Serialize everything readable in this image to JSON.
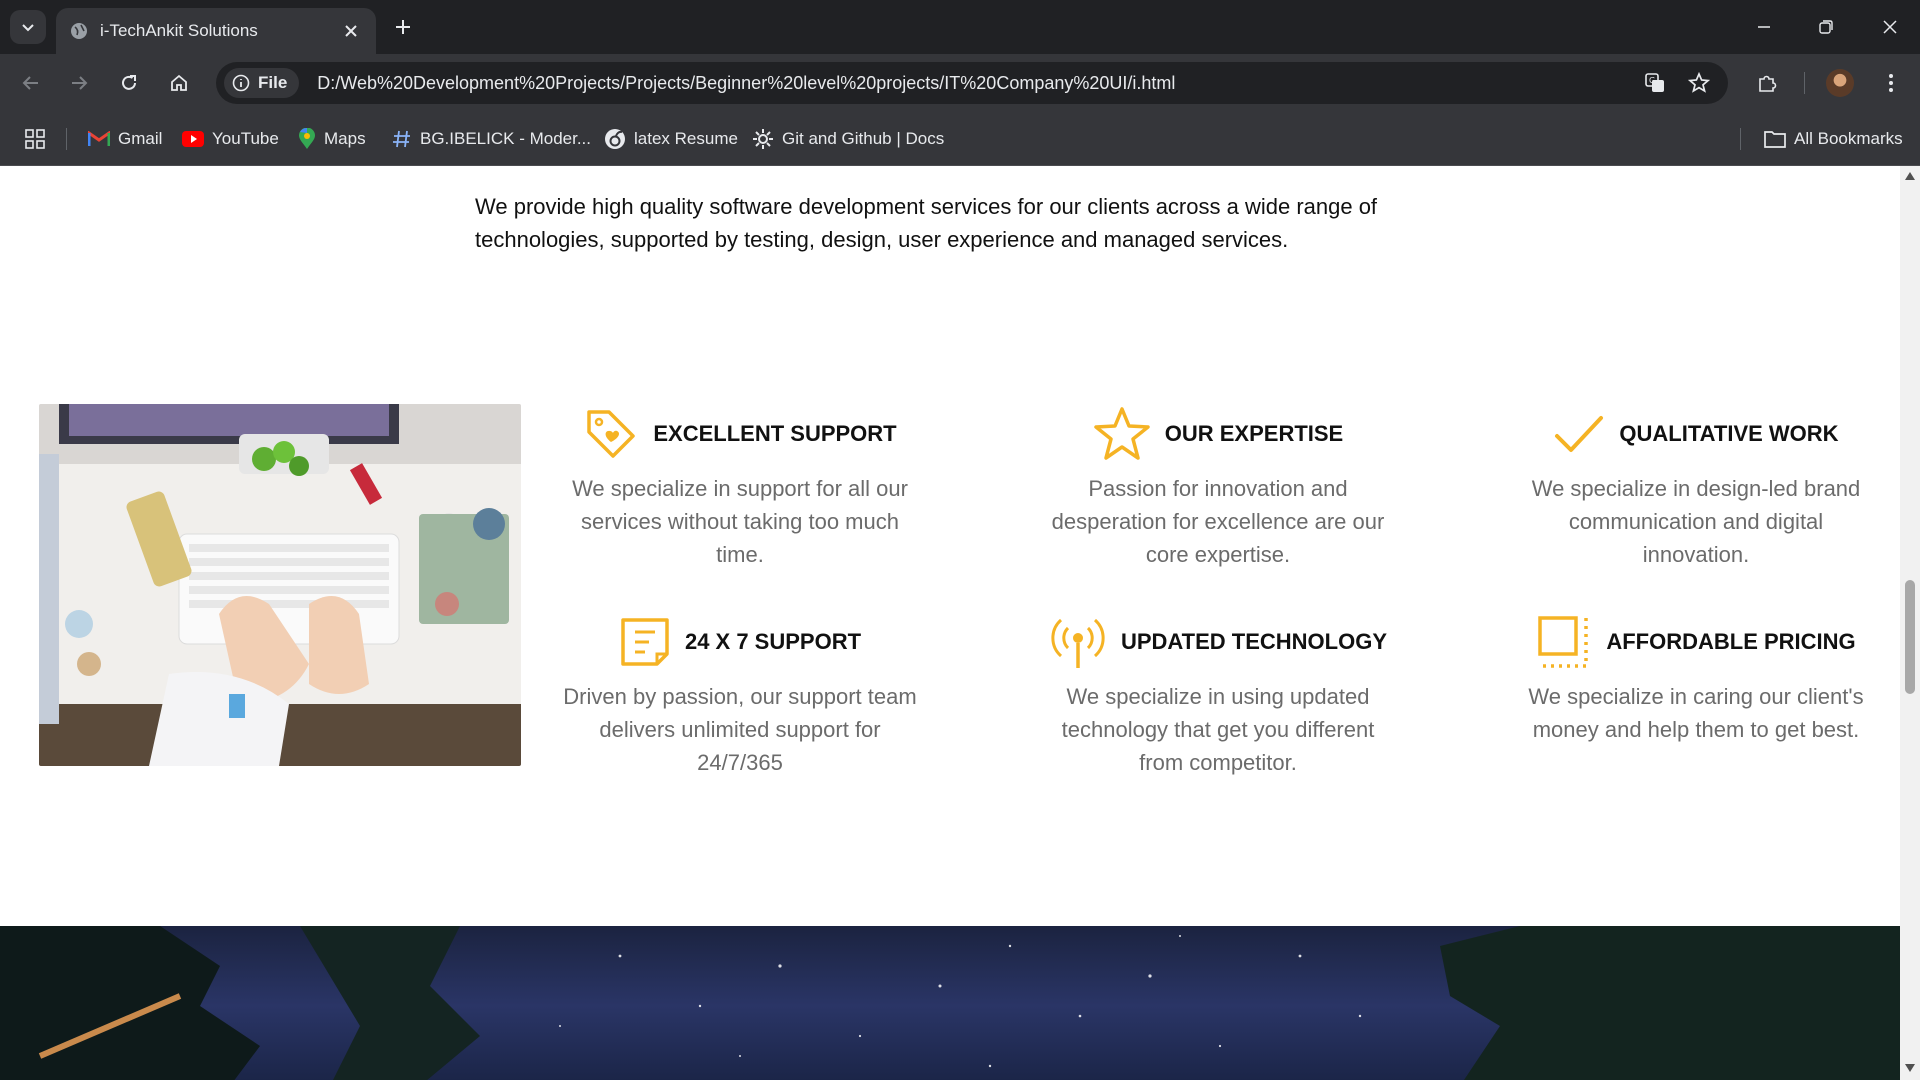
{
  "browser": {
    "tab_title": "i-TechAnkit Solutions",
    "site_chip": "File",
    "url": "D:/Web%20Development%20Projects/Projects/Beginner%20level%20projects/IT%20Company%20UI/i.html",
    "bookmarks": [
      "Gmail",
      "YouTube",
      "Maps",
      "BG.IBELICK - Moder...",
      "latex Resume",
      "Git and Github | Docs"
    ],
    "all_bookmarks": "All Bookmarks"
  },
  "content": {
    "intro": "We provide high quality software development services for our clients across a wide range of technologies, supported by testing, design, user experience and managed services.",
    "accent_color": "#f5b324",
    "features": [
      {
        "icon": "tag-heart-icon",
        "title": "EXCELLENT SUPPORT",
        "desc": "We specialize in support for all our services without taking too much time."
      },
      {
        "icon": "star-icon",
        "title": "OUR EXPERTISE",
        "desc": "Passion for innovation and desperation for excellence are our core expertise."
      },
      {
        "icon": "checkmark-icon",
        "title": "QUALITATIVE WORK",
        "desc": "We specialize in design-led brand communication and digital innovation."
      },
      {
        "icon": "document-icon",
        "title": "24 X 7 SUPPORT",
        "desc": "Driven by passion, our support team delivers unlimited support for 24/7/365"
      },
      {
        "icon": "antenna-icon",
        "title": "UPDATED TECHNOLOGY",
        "desc": "We specialize in using updated technology that get you different from competitor."
      },
      {
        "icon": "square-dotted-icon",
        "title": "AFFORDABLE PRICING",
        "desc": "We specialize in caring our client's money and help them to get best."
      }
    ]
  }
}
